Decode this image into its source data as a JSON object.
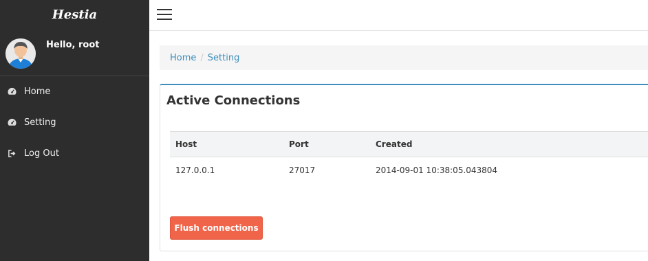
{
  "brand": "Hestia",
  "user": {
    "greeting": "Hello, root"
  },
  "menu": [
    {
      "label": "Home",
      "icon": "dashboard-icon"
    },
    {
      "label": "Setting",
      "icon": "dashboard-icon"
    },
    {
      "label": "Log Out",
      "icon": "sign-out-icon"
    }
  ],
  "breadcrumb": {
    "home": "Home",
    "separator": "/",
    "current": "Setting"
  },
  "panel": {
    "title": "Active Connections",
    "columns": [
      "Host",
      "Port",
      "Created"
    ],
    "rows": [
      {
        "host": "127.0.0.1",
        "port": "27017",
        "created": "2014-09-01 10:38:05.043804"
      }
    ],
    "flush_label": "Flush connections"
  },
  "colors": {
    "sidebar": "#2d2d2d",
    "accent": "#3c8dbc",
    "danger": "#f0644a"
  }
}
